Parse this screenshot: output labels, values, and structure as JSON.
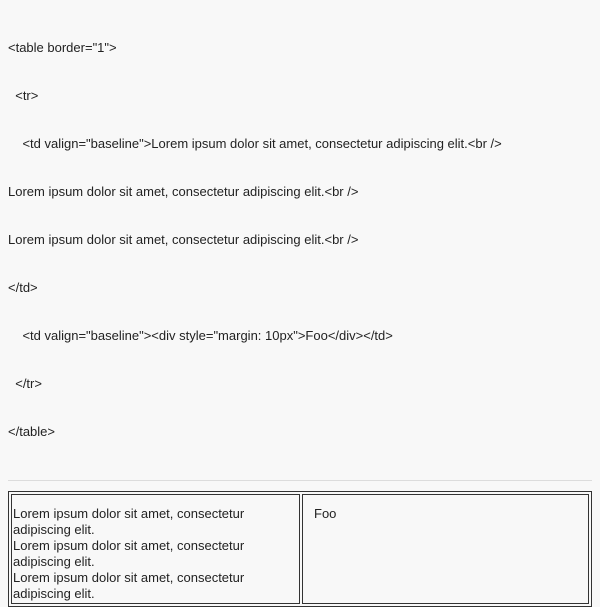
{
  "source_code": {
    "lines": [
      "<table border=\"1\">",
      "  <tr>",
      "    <td valign=\"baseline\">Lorem ipsum dolor sit amet, consectetur adipiscing elit.<br />",
      "Lorem ipsum dolor sit amet, consectetur adipiscing elit.<br />",
      "Lorem ipsum dolor sit amet, consectetur adipiscing elit.<br />",
      "</td>",
      "    <td valign=\"baseline\"><div style=\"margin: 10px\">Foo</div></td>",
      "  </tr>",
      "</table>"
    ]
  },
  "rendered_table": {
    "left_cell_lines": [
      "Lorem ipsum dolor sit amet, consectetur adipiscing elit.",
      "Lorem ipsum dolor sit amet, consectetur adipiscing elit.",
      "Lorem ipsum dolor sit amet, consectetur adipiscing elit."
    ],
    "right_cell_text": "Foo"
  }
}
